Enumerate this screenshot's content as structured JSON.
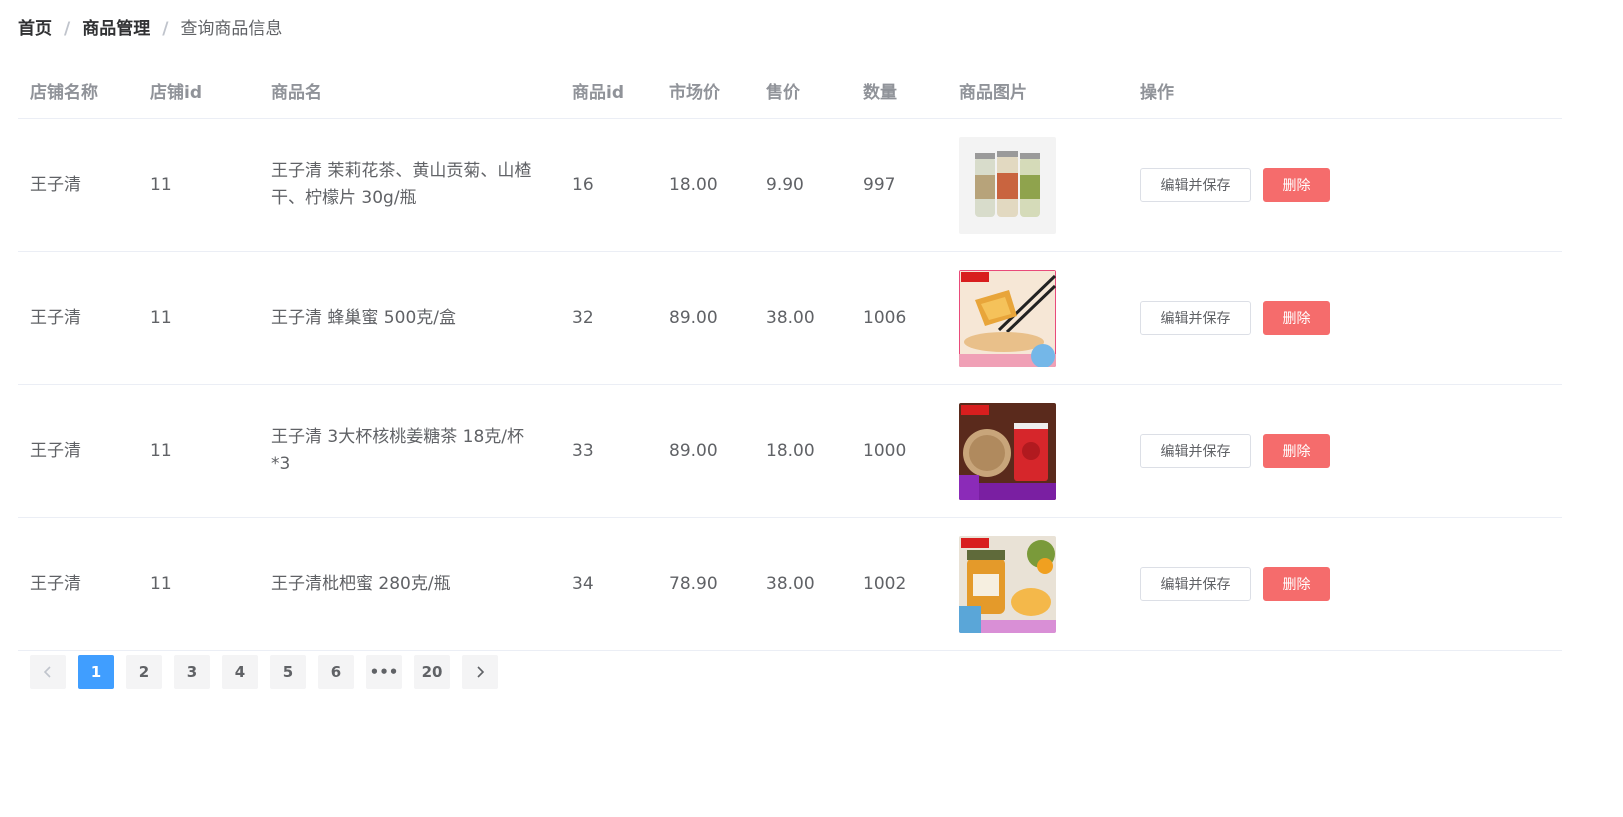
{
  "breadcrumb": {
    "home": "首页",
    "section": "商品管理",
    "current": "查询商品信息",
    "separator": "/"
  },
  "table": {
    "columns": [
      "店铺名称",
      "店铺id",
      "商品名",
      "商品id",
      "市场价",
      "售价",
      "数量",
      "商品图片",
      "操作"
    ],
    "rows": [
      {
        "shop_name": "王子清",
        "shop_id": "11",
        "product_name": "王子清 茉莉花茶、黄山贡菊、山楂干、柠檬片 30g/瓶",
        "product_id": "16",
        "market_price": "18.00",
        "price": "9.90",
        "quantity": "997"
      },
      {
        "shop_name": "王子清",
        "shop_id": "11",
        "product_name": "王子清 蜂巢蜜 500克/盒",
        "product_id": "32",
        "market_price": "89.00",
        "price": "38.00",
        "quantity": "1006"
      },
      {
        "shop_name": "王子清",
        "shop_id": "11",
        "product_name": "王子清 3大杯核桃姜糖茶 18克/杯*3",
        "product_id": "33",
        "market_price": "89.00",
        "price": "18.00",
        "quantity": "1000"
      },
      {
        "shop_name": "王子清",
        "shop_id": "11",
        "product_name": "王子清枇杷蜜 280克/瓶",
        "product_id": "34",
        "market_price": "78.90",
        "price": "38.00",
        "quantity": "1002"
      }
    ],
    "actions": {
      "edit_label": "编辑并保存",
      "delete_label": "删除"
    }
  },
  "pagination": {
    "prev_icon": "chevron-left-icon",
    "next_icon": "chevron-right-icon",
    "pages": [
      "1",
      "2",
      "3",
      "4",
      "5",
      "6",
      "•••",
      "20"
    ],
    "current": "1"
  },
  "colors": {
    "primary": "#409eff",
    "danger": "#f56c6c",
    "header_text": "#909399",
    "body_text": "#606266",
    "border": "#ebeef5"
  }
}
